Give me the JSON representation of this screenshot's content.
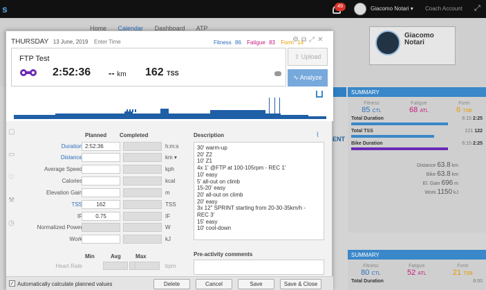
{
  "app": {
    "notification_count": "49",
    "user_name": "Giacomo Notari",
    "coach_account": "Coach Account",
    "nav": [
      "Home",
      "Calendar",
      "Dashboard",
      "ATP"
    ],
    "brand_logo_text": [
      "Giacomo",
      "Notari"
    ],
    "bg_link": "ENT"
  },
  "summary1": {
    "header": "SUMMARY",
    "fitness": {
      "label": "Fitness",
      "value": "85",
      "unit": "CTL"
    },
    "fatigue": {
      "label": "Fatigue",
      "value": "68",
      "unit": "ATL"
    },
    "form": {
      "label": "Form",
      "value": "6",
      "unit": "TSB"
    },
    "total_duration": {
      "label": "Total Duration",
      "v1": "6:15",
      "v2": "2:25"
    },
    "total_tss": {
      "label": "Total TSS",
      "v1": "221",
      "v2": "122"
    },
    "bike_duration": {
      "label": "Bike Duration",
      "v1": "6:15",
      "v2": "2:25"
    },
    "distance": {
      "label": "Distance",
      "value": "63.8",
      "unit": "km"
    },
    "bike": {
      "label": "Bike",
      "value": "63.8",
      "unit": "km"
    },
    "el_gain": {
      "label": "El. Gain",
      "value": "696",
      "unit": "m"
    },
    "work": {
      "label": "Work",
      "value": "1150",
      "unit": "kJ"
    }
  },
  "summary2": {
    "header": "SUMMARY",
    "fitness": {
      "label": "Fitness",
      "value": "80",
      "unit": "CTL"
    },
    "fatigue": {
      "label": "Fatigue",
      "value": "52",
      "unit": "ATL"
    },
    "form": {
      "label": "Form",
      "value": "21",
      "unit": "TSB"
    },
    "total_duration": {
      "label": "Total Duration",
      "v1": "6:00",
      "v2": ""
    }
  },
  "modal": {
    "day": "THURSDAY",
    "date": "13 June, 2019",
    "enter_time": "Enter Time",
    "fitness_label": "Fitness",
    "fitness_value": "86",
    "fatigue_label": "Fatigue",
    "fatigue_value": "83",
    "form_label": "Form",
    "form_value": "14",
    "workout_title": "FTP Test",
    "duration": "2:52:36",
    "distance": "--",
    "distance_unit": "km",
    "tss": "162",
    "tss_unit": "TSS",
    "upload": "Upload",
    "analyze": "Analyze",
    "col_planned": "Planned",
    "col_completed": "Completed",
    "rows": [
      {
        "label": "Duration",
        "planned": "2:52:36",
        "unit": "h:m:s",
        "link": true
      },
      {
        "label": "Distance",
        "planned": "",
        "unit": "km",
        "link": true
      },
      {
        "label": "Average Speed",
        "planned": "",
        "unit": "kph"
      },
      {
        "label": "Calories",
        "planned": "",
        "unit": "kcal"
      },
      {
        "label": "Elevation Gain",
        "planned": "",
        "unit": "m"
      },
      {
        "label": "TSS",
        "planned": "162",
        "unit": "TSS",
        "link": true
      },
      {
        "label": "IF",
        "planned": "0.75",
        "unit": "IF"
      },
      {
        "label": "Normalized Power",
        "planned": "",
        "unit": "W"
      },
      {
        "label": "Work",
        "planned": "",
        "unit": "kJ"
      }
    ],
    "min_label": "Min",
    "avg_label": "Avg",
    "max_label": "Max",
    "hr_label": "Heart Rate",
    "hr_unit": "bpm",
    "description_label": "Description",
    "description_lines": [
      "30' warm-up",
      "20' Z2",
      "10' Z1",
      "4x 1' @FTP at 100-105rpm - REC 1'",
      "10' easy",
      "5' all-out on climb",
      "15-20' easy",
      "20' all-out on climb",
      "20' easy",
      "3x 12\" SPRINT starting from 20-30-35km/h -",
      "REC 3'",
      "15' easy",
      "10' cool-down"
    ],
    "pre_comments_label": "Pre-activity comments",
    "auto_calc_label": "Automatically calculate planned values",
    "delete": "Delete",
    "cancel": "Cancel",
    "save": "Save",
    "save_close": "Save & Close"
  },
  "colors": {
    "accent": "#3a87c9",
    "fitness": "#2a6ebb",
    "fatigue": "#c3197c",
    "form": "#e59a00",
    "workout_bike": "#6a2bb5"
  }
}
